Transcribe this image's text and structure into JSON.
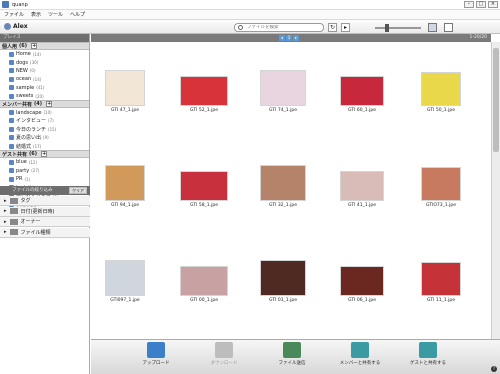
{
  "window": {
    "title": "quanp"
  },
  "menu": [
    "ファイル",
    "表示",
    "ツール",
    "ヘルプ"
  ],
  "toolbar": {
    "user": "Alex",
    "search_placeholder": "ファイルを検索"
  },
  "sidebar": {
    "header": "プレイス",
    "personal": {
      "label": "個人用",
      "count": "(6)",
      "items": [
        {
          "label": "Home",
          "count": "(14)"
        },
        {
          "label": "dogs",
          "count": "(30)"
        },
        {
          "label": "NEW",
          "count": "(0)"
        },
        {
          "label": "ocean",
          "count": "(14)"
        },
        {
          "label": "sample",
          "count": "(41)"
        },
        {
          "label": "sweets",
          "count": "(20)"
        }
      ]
    },
    "members": {
      "label": "メンバー共有",
      "count": "(4)",
      "items": [
        {
          "label": "landscape",
          "count": "(10)"
        },
        {
          "label": "インタビュー",
          "count": "(7)"
        },
        {
          "label": "今日のランチ",
          "count": "(15)"
        },
        {
          "label": "夏の思い出",
          "count": "(9)"
        },
        {
          "label": "結婚式",
          "count": "(17)"
        }
      ]
    },
    "guests": {
      "label": "ゲスト共有",
      "count": "(6)",
      "items": [
        {
          "label": "blue",
          "count": "(12)"
        },
        {
          "label": "party",
          "count": "(27)"
        },
        {
          "label": "PR",
          "count": "(1)"
        },
        {
          "label": "test",
          "count": "(3)"
        },
        {
          "label": "デジタルカメラ",
          "count": "(5)"
        },
        {
          "label": "債権収支",
          "count": "(4)"
        }
      ]
    },
    "filter": {
      "header": "ファイルの絞り込み",
      "clear": "クリア",
      "rows": [
        "タグ",
        "日付(更新日時)",
        "オーナー",
        "ファイル種類"
      ]
    }
  },
  "gallery": {
    "range": "1-20/20",
    "page": "1",
    "files": [
      {
        "name": "GTI 47_1.jpe",
        "color": "#f2e6d6"
      },
      {
        "name": "GTI 52_1.jpe",
        "color": "#d8323a"
      },
      {
        "name": "GTI 74_1.jpe",
        "color": "#e9d5df"
      },
      {
        "name": "GTI 60_1.jpe",
        "color": "#c8283c"
      },
      {
        "name": "GTI 50_1.jpe",
        "color": "#e8d84a"
      },
      {
        "name": "GTI 94_1.jpe",
        "color": "#d29a5a"
      },
      {
        "name": "GTI 58_1.jpe",
        "color": "#c8303e"
      },
      {
        "name": "GTI 32_1.jpe",
        "color": "#b5826a"
      },
      {
        "name": "GTI 41_1.jpe",
        "color": "#d9bcb8"
      },
      {
        "name": "GTIO73_1.jpe",
        "color": "#c87a60"
      },
      {
        "name": "GTI097_1.jpe",
        "color": "#cfd6de"
      },
      {
        "name": "GTI 00_1.jpe",
        "color": "#c8a2a2"
      },
      {
        "name": "GTI 01_1.jpe",
        "color": "#4e2a22"
      },
      {
        "name": "GTI 06_1.jpe",
        "color": "#6a2820"
      },
      {
        "name": "GTI 11_1.jpe",
        "color": "#c53238"
      }
    ]
  },
  "actions": [
    {
      "label": "アップロード",
      "color": "#3a7fc8"
    },
    {
      "label": "ダウンロード",
      "color": "#bdbdbd"
    },
    {
      "label": "ファイル送信",
      "color": "#4a8a5a"
    },
    {
      "label": "メンバーと共有する",
      "color": "#3b9aa2"
    },
    {
      "label": "ゲストと共有する",
      "color": "#3b9aa2"
    }
  ]
}
